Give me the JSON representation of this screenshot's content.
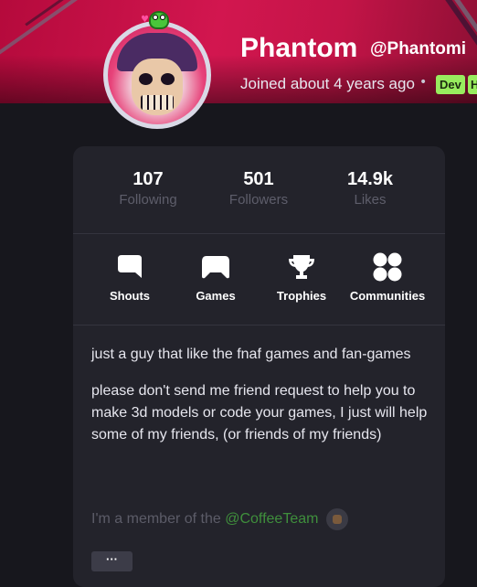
{
  "profile": {
    "display_name": "Phantom",
    "handle": "@Phantomi",
    "joined": "Joined about 4 years ago",
    "separator": "•",
    "tags": [
      "Dev",
      "H"
    ]
  },
  "stats": [
    {
      "value": "107",
      "label": "Following"
    },
    {
      "value": "501",
      "label": "Followers"
    },
    {
      "value": "14.9k",
      "label": "Likes"
    }
  ],
  "nav": [
    {
      "label": "Shouts",
      "icon": "speech-bubble-icon"
    },
    {
      "label": "Games",
      "icon": "gamepad-icon"
    },
    {
      "label": "Trophies",
      "icon": "trophy-icon"
    },
    {
      "label": "Communities",
      "icon": "communities-icon"
    }
  ],
  "bio": {
    "line1": "just a guy that like the fnaf games and fan-games",
    "line2": "please don't send me friend request to help you to make 3d models or code your games, I just will help some of my friends, (or friends of my friends)"
  },
  "member": {
    "prefix": "I'm a  member of the",
    "team": "@CoffeeTeam"
  },
  "more_button": "···",
  "colors": {
    "banner": "#d2164f",
    "background": "#17171d",
    "card": "#23232b",
    "tag": "#98ec5e",
    "team_link": "#3f8f3c"
  }
}
